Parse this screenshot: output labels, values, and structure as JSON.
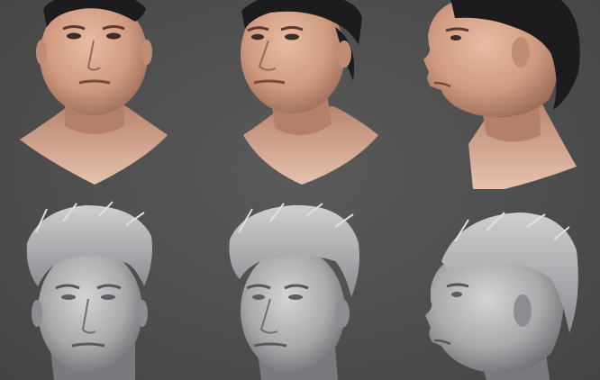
{
  "scene": {
    "background_color": "#505050",
    "rows": [
      {
        "material": "textured",
        "skin_color": "#d9a88f",
        "shadow_color": "#9a6a58",
        "hair_color": "#1c1c1e",
        "views": [
          "front",
          "three-quarter",
          "profile"
        ]
      },
      {
        "material": "clay",
        "skin_color": "#b9b9bb",
        "shadow_color": "#6e6e72",
        "hair_color": "#a9a9ad",
        "views": [
          "front",
          "three-quarter",
          "profile"
        ]
      }
    ]
  }
}
